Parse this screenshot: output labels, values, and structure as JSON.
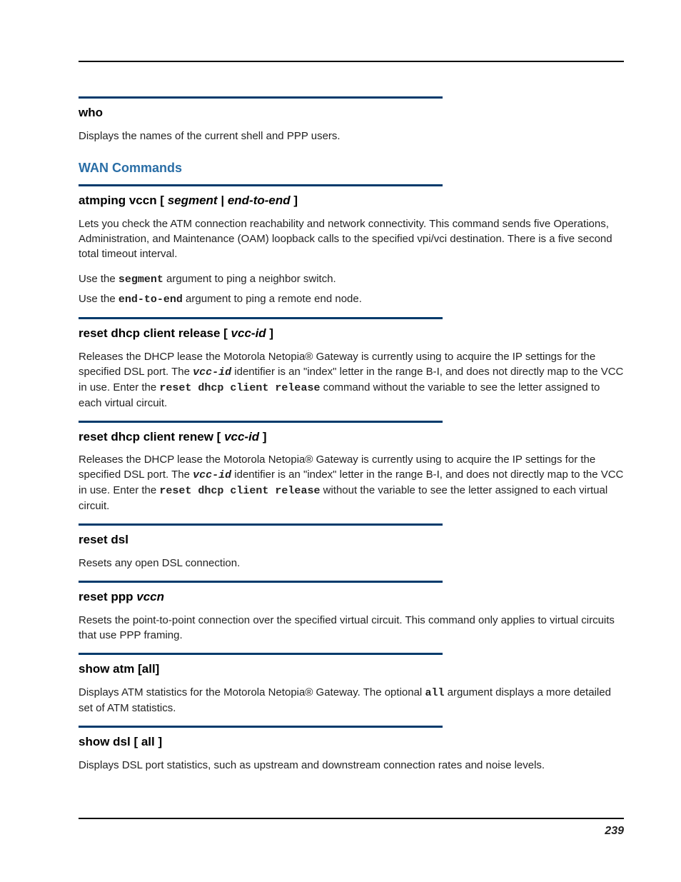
{
  "pageNumber": "239",
  "who": {
    "title": "who",
    "body": "Displays the names of the current shell and PPP users."
  },
  "wanHeading": "WAN Commands",
  "atmping": {
    "title_prefix": "atmping vccn [ ",
    "title_arg1": "segment",
    "title_sep": " | ",
    "title_arg2": "end-to-end",
    "title_suffix": " ]",
    "para1": "Lets you check the ATM connection reachability and network connectivity. This command sends five Operations, Administration, and Maintenance (OAM) loopback calls to the specified vpi/vci destination. There is a five second total timeout interval.",
    "use1_pre": "Use the ",
    "use1_code": "segment",
    "use1_post": " argument to ping a neighbor switch.",
    "use2_pre": "Use the ",
    "use2_code": "end-to-end",
    "use2_post": " argument to ping a remote end node."
  },
  "resetRelease": {
    "title_prefix": "reset dhcp client release [ ",
    "title_arg": "vcc-id",
    "title_suffix": " ]",
    "p_a": "Releases the DHCP lease the Motorola Netopia® Gateway is currently using to acquire the IP settings for the specified DSL port. The ",
    "p_code1": "vcc-id",
    "p_b": " identifier is an \"index\" letter in the range B-I, and does not directly map to the VCC in use. Enter the ",
    "p_code2": "reset dhcp client release",
    "p_c": " command without the variable to see the letter assigned to each virtual circuit."
  },
  "resetRenew": {
    "title_prefix": "reset dhcp client renew [ ",
    "title_arg": "vcc-id",
    "title_suffix": " ]",
    "p_a": "Releases the DHCP lease the Motorola Netopia® Gateway is currently using to acquire the IP settings for the specified DSL port. The ",
    "p_code1": "vcc-id",
    "p_b": " identifier is an \"index\" letter in the range B-I, and does not directly map to the VCC in use. Enter the ",
    "p_code2": "reset dhcp client release",
    "p_c": " without the variable to see the letter assigned to each virtual circuit."
  },
  "resetDsl": {
    "title": "reset dsl",
    "body": "Resets any open DSL connection."
  },
  "resetPpp": {
    "title_prefix": "reset ppp ",
    "title_arg": "vccn",
    "body": "Resets the point-to-point connection over the specified virtual circuit. This command only applies to virtual circuits that use PPP framing."
  },
  "showAtm": {
    "title": "show atm [all]",
    "p_a": "Displays ATM statistics for the Motorola Netopia® Gateway. The optional ",
    "p_code": "all",
    "p_b": " argument displays a more detailed set of ATM statistics."
  },
  "showDsl": {
    "title": "show dsl [ all ]",
    "body": "Displays DSL port statistics, such as upstream and downstream connection rates and noise levels."
  }
}
